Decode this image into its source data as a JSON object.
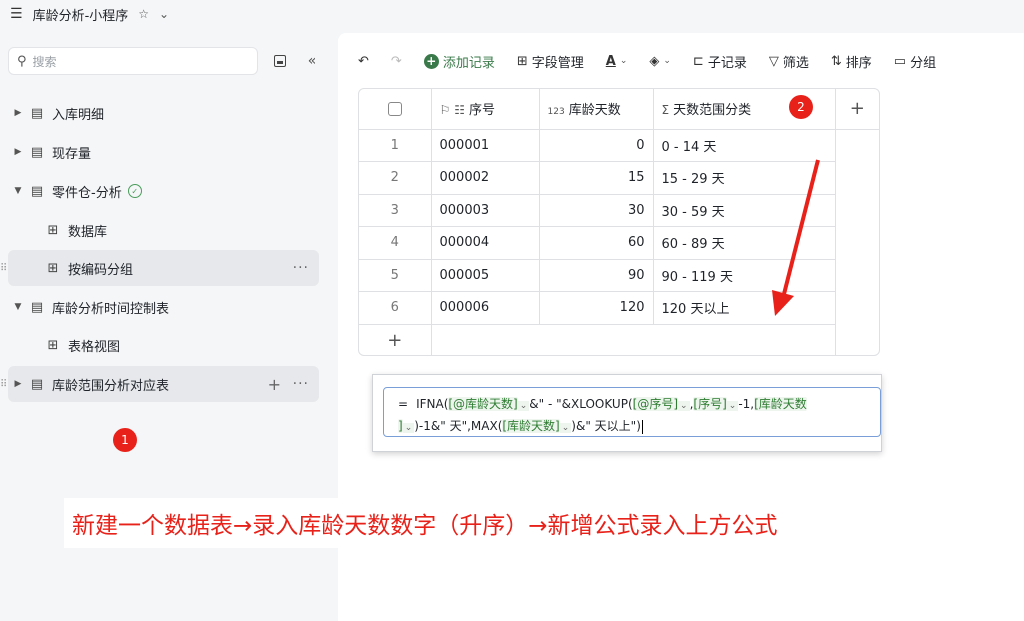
{
  "titlebar": {
    "menu_icon": "hamburger-icon",
    "title": "库龄分析-小程序"
  },
  "sidebar": {
    "search_placeholder": "搜索",
    "items": [
      {
        "label": "入库明细"
      },
      {
        "label": "现存量"
      },
      {
        "label": "零件仓-分析"
      },
      {
        "label": "数据库"
      },
      {
        "label": "按编码分组"
      },
      {
        "label": "库龄分析时间控制表"
      },
      {
        "label": "表格视图"
      },
      {
        "label": "库龄范围分析对应表"
      }
    ]
  },
  "annotations": {
    "badge1": "1",
    "badge2": "2",
    "caption": "新建一个数据表→录入库龄天数数字（升序）→新增公式录入上方公式"
  },
  "toolbar": {
    "add_record": "添加记录",
    "field_manage": "字段管理",
    "sub_record": "子记录",
    "filter": "筛选",
    "sort": "排序",
    "group": "分组"
  },
  "table": {
    "columns": [
      "序号",
      "库龄天数",
      "天数范围分类"
    ],
    "col_icons": {
      "seq": "123",
      "formula": "Σ"
    },
    "rows": [
      {
        "idx": "1",
        "seq": "000001",
        "days": "0",
        "range": "0 - 14 天"
      },
      {
        "idx": "2",
        "seq": "000002",
        "days": "15",
        "range": "15 - 29 天"
      },
      {
        "idx": "3",
        "seq": "000003",
        "days": "30",
        "range": "30 - 59 天"
      },
      {
        "idx": "4",
        "seq": "000004",
        "days": "60",
        "range": "60 - 89 天"
      },
      {
        "idx": "5",
        "seq": "000005",
        "days": "90",
        "range": "90 - 119 天"
      },
      {
        "idx": "6",
        "seq": "000006",
        "days": "120",
        "range": "120 天以上"
      }
    ]
  },
  "formula": {
    "eq": "=",
    "p1": "IFNA(",
    "r1": "[@库龄天数]",
    "p2": "&\" - \"&XLOOKUP(",
    "r2": "[@序号]",
    "p3": ",",
    "r3": "[序号]",
    "p4": "-1,",
    "r4a": "[库龄天数",
    "r4b": "]",
    "p5": ")-1&\" 天\",MAX(",
    "r5": "[库龄天数]",
    "p6": ")&\" 天以上\")"
  },
  "colors": {
    "accent_green": "#3a7a4a",
    "badge_red": "#e8221a",
    "ref_green": "#2e7d32"
  }
}
